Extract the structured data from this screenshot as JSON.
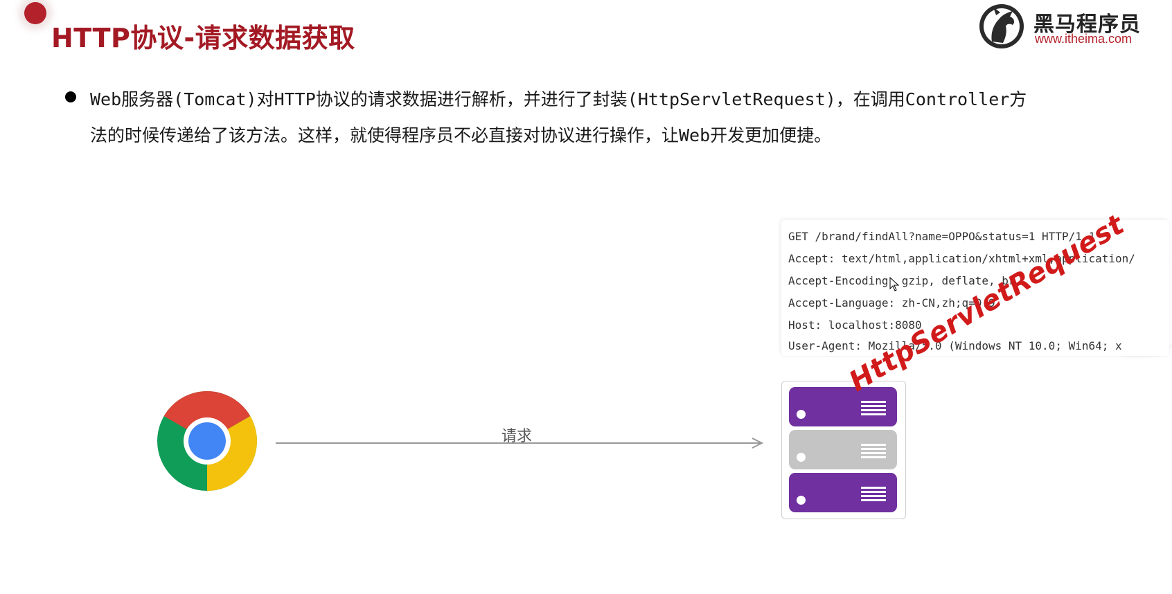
{
  "slide": {
    "title": "HTTP协议-请求数据获取",
    "bullet_line1": "Web服务器(Tomcat)对HTTP协议的请求数据进行解析，并进行了封装(HttpServletRequest)，在调用Controller方",
    "bullet_line2": "法的时候传递给了该方法。这样，就使得程序员不必直接对协议进行操作，让Web开发更加便捷。"
  },
  "logo": {
    "name": "黑马程序员",
    "url": "www.itheima.com",
    "icon": "horse-head-icon"
  },
  "diagram": {
    "client_icon": "chrome-browser-icon",
    "arrow_label": "请求",
    "server_icon": "server-rack-icon",
    "request_lines": [
      "GET /brand/findAll?name=OPPO&status=1 HTTP/1.1",
      "Accept: text/html,application/xhtml+xml,application/",
      "Accept-Encoding: gzip, deflate, br",
      "Accept-Language: zh-CN,zh;q=0.9",
      "Host: localhost:8080",
      "User-Agent: Mozilla/5.0 (Windows NT 10.0; Win64; x"
    ],
    "stamp_text": "HttpServletRequest"
  },
  "colors": {
    "title_red": "#a31a24",
    "stamp_red": "#d11a1a",
    "server_purple": "#7030a0",
    "server_gray": "#c4c4c4",
    "chrome_red": "#db4437",
    "chrome_yellow": "#f4c20d",
    "chrome_green": "#0f9d58",
    "chrome_blue": "#4285f4"
  }
}
